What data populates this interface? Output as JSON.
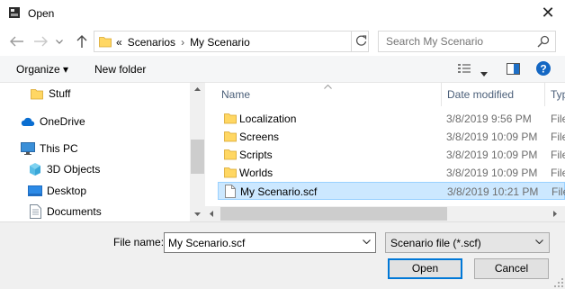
{
  "window": {
    "title": "Open",
    "close_glyph": "✕"
  },
  "address": {
    "overflow": "«",
    "crumbs": [
      "Scenarios",
      "My Scenario"
    ],
    "separator": "›"
  },
  "search": {
    "placeholder": "Search My Scenario"
  },
  "toolbar": {
    "organize_label": "Organize ▾",
    "new_folder_label": "New folder"
  },
  "nav_items": [
    {
      "label": "Stuff",
      "icon": "folder-icon"
    },
    {
      "label": "OneDrive",
      "icon": "cloud-icon"
    },
    {
      "label": "This PC",
      "icon": "computer-icon"
    },
    {
      "label": "3D Objects",
      "icon": "cube-icon"
    },
    {
      "label": "Desktop",
      "icon": "desktop-icon"
    },
    {
      "label": "Documents",
      "icon": "document-icon"
    }
  ],
  "columns": {
    "name": "Name",
    "date": "Date modified",
    "type": "Typ"
  },
  "files": [
    {
      "name": "Localization",
      "date": "3/8/2019 9:56 PM",
      "type": "File",
      "kind": "folder"
    },
    {
      "name": "Screens",
      "date": "3/8/2019 10:09 PM",
      "type": "File",
      "kind": "folder"
    },
    {
      "name": "Scripts",
      "date": "3/8/2019 10:09 PM",
      "type": "File",
      "kind": "folder"
    },
    {
      "name": "Worlds",
      "date": "3/8/2019 10:09 PM",
      "type": "File",
      "kind": "folder"
    },
    {
      "name": "My Scenario.scf",
      "date": "3/8/2019 10:21 PM",
      "type": "File",
      "kind": "file"
    }
  ],
  "selected_file_index": 4,
  "footer": {
    "file_name_label": "File name:",
    "file_name_value": "My Scenario.scf",
    "file_type": "Scenario file (*.scf)",
    "open_label": "Open",
    "cancel_label": "Cancel"
  },
  "colors": {
    "accent": "#0078d7",
    "selection": "#cce8ff",
    "folder": "#ffd763",
    "header_text": "#4c607a"
  }
}
